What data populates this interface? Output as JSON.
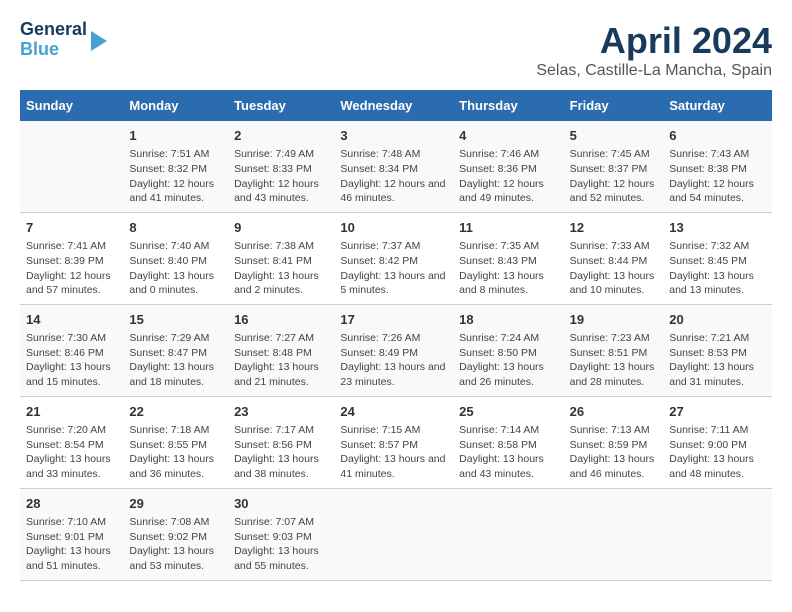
{
  "logo": {
    "line1": "General",
    "line2": "Blue"
  },
  "title": "April 2024",
  "subtitle": "Selas, Castille-La Mancha, Spain",
  "days_header": [
    "Sunday",
    "Monday",
    "Tuesday",
    "Wednesday",
    "Thursday",
    "Friday",
    "Saturday"
  ],
  "weeks": [
    [
      {
        "day": "",
        "sunrise": "",
        "sunset": "",
        "daylight": ""
      },
      {
        "day": "1",
        "sunrise": "Sunrise: 7:51 AM",
        "sunset": "Sunset: 8:32 PM",
        "daylight": "Daylight: 12 hours and 41 minutes."
      },
      {
        "day": "2",
        "sunrise": "Sunrise: 7:49 AM",
        "sunset": "Sunset: 8:33 PM",
        "daylight": "Daylight: 12 hours and 43 minutes."
      },
      {
        "day": "3",
        "sunrise": "Sunrise: 7:48 AM",
        "sunset": "Sunset: 8:34 PM",
        "daylight": "Daylight: 12 hours and 46 minutes."
      },
      {
        "day": "4",
        "sunrise": "Sunrise: 7:46 AM",
        "sunset": "Sunset: 8:36 PM",
        "daylight": "Daylight: 12 hours and 49 minutes."
      },
      {
        "day": "5",
        "sunrise": "Sunrise: 7:45 AM",
        "sunset": "Sunset: 8:37 PM",
        "daylight": "Daylight: 12 hours and 52 minutes."
      },
      {
        "day": "6",
        "sunrise": "Sunrise: 7:43 AM",
        "sunset": "Sunset: 8:38 PM",
        "daylight": "Daylight: 12 hours and 54 minutes."
      }
    ],
    [
      {
        "day": "7",
        "sunrise": "Sunrise: 7:41 AM",
        "sunset": "Sunset: 8:39 PM",
        "daylight": "Daylight: 12 hours and 57 minutes."
      },
      {
        "day": "8",
        "sunrise": "Sunrise: 7:40 AM",
        "sunset": "Sunset: 8:40 PM",
        "daylight": "Daylight: 13 hours and 0 minutes."
      },
      {
        "day": "9",
        "sunrise": "Sunrise: 7:38 AM",
        "sunset": "Sunset: 8:41 PM",
        "daylight": "Daylight: 13 hours and 2 minutes."
      },
      {
        "day": "10",
        "sunrise": "Sunrise: 7:37 AM",
        "sunset": "Sunset: 8:42 PM",
        "daylight": "Daylight: 13 hours and 5 minutes."
      },
      {
        "day": "11",
        "sunrise": "Sunrise: 7:35 AM",
        "sunset": "Sunset: 8:43 PM",
        "daylight": "Daylight: 13 hours and 8 minutes."
      },
      {
        "day": "12",
        "sunrise": "Sunrise: 7:33 AM",
        "sunset": "Sunset: 8:44 PM",
        "daylight": "Daylight: 13 hours and 10 minutes."
      },
      {
        "day": "13",
        "sunrise": "Sunrise: 7:32 AM",
        "sunset": "Sunset: 8:45 PM",
        "daylight": "Daylight: 13 hours and 13 minutes."
      }
    ],
    [
      {
        "day": "14",
        "sunrise": "Sunrise: 7:30 AM",
        "sunset": "Sunset: 8:46 PM",
        "daylight": "Daylight: 13 hours and 15 minutes."
      },
      {
        "day": "15",
        "sunrise": "Sunrise: 7:29 AM",
        "sunset": "Sunset: 8:47 PM",
        "daylight": "Daylight: 13 hours and 18 minutes."
      },
      {
        "day": "16",
        "sunrise": "Sunrise: 7:27 AM",
        "sunset": "Sunset: 8:48 PM",
        "daylight": "Daylight: 13 hours and 21 minutes."
      },
      {
        "day": "17",
        "sunrise": "Sunrise: 7:26 AM",
        "sunset": "Sunset: 8:49 PM",
        "daylight": "Daylight: 13 hours and 23 minutes."
      },
      {
        "day": "18",
        "sunrise": "Sunrise: 7:24 AM",
        "sunset": "Sunset: 8:50 PM",
        "daylight": "Daylight: 13 hours and 26 minutes."
      },
      {
        "day": "19",
        "sunrise": "Sunrise: 7:23 AM",
        "sunset": "Sunset: 8:51 PM",
        "daylight": "Daylight: 13 hours and 28 minutes."
      },
      {
        "day": "20",
        "sunrise": "Sunrise: 7:21 AM",
        "sunset": "Sunset: 8:53 PM",
        "daylight": "Daylight: 13 hours and 31 minutes."
      }
    ],
    [
      {
        "day": "21",
        "sunrise": "Sunrise: 7:20 AM",
        "sunset": "Sunset: 8:54 PM",
        "daylight": "Daylight: 13 hours and 33 minutes."
      },
      {
        "day": "22",
        "sunrise": "Sunrise: 7:18 AM",
        "sunset": "Sunset: 8:55 PM",
        "daylight": "Daylight: 13 hours and 36 minutes."
      },
      {
        "day": "23",
        "sunrise": "Sunrise: 7:17 AM",
        "sunset": "Sunset: 8:56 PM",
        "daylight": "Daylight: 13 hours and 38 minutes."
      },
      {
        "day": "24",
        "sunrise": "Sunrise: 7:15 AM",
        "sunset": "Sunset: 8:57 PM",
        "daylight": "Daylight: 13 hours and 41 minutes."
      },
      {
        "day": "25",
        "sunrise": "Sunrise: 7:14 AM",
        "sunset": "Sunset: 8:58 PM",
        "daylight": "Daylight: 13 hours and 43 minutes."
      },
      {
        "day": "26",
        "sunrise": "Sunrise: 7:13 AM",
        "sunset": "Sunset: 8:59 PM",
        "daylight": "Daylight: 13 hours and 46 minutes."
      },
      {
        "day": "27",
        "sunrise": "Sunrise: 7:11 AM",
        "sunset": "Sunset: 9:00 PM",
        "daylight": "Daylight: 13 hours and 48 minutes."
      }
    ],
    [
      {
        "day": "28",
        "sunrise": "Sunrise: 7:10 AM",
        "sunset": "Sunset: 9:01 PM",
        "daylight": "Daylight: 13 hours and 51 minutes."
      },
      {
        "day": "29",
        "sunrise": "Sunrise: 7:08 AM",
        "sunset": "Sunset: 9:02 PM",
        "daylight": "Daylight: 13 hours and 53 minutes."
      },
      {
        "day": "30",
        "sunrise": "Sunrise: 7:07 AM",
        "sunset": "Sunset: 9:03 PM",
        "daylight": "Daylight: 13 hours and 55 minutes."
      },
      {
        "day": "",
        "sunrise": "",
        "sunset": "",
        "daylight": ""
      },
      {
        "day": "",
        "sunrise": "",
        "sunset": "",
        "daylight": ""
      },
      {
        "day": "",
        "sunrise": "",
        "sunset": "",
        "daylight": ""
      },
      {
        "day": "",
        "sunrise": "",
        "sunset": "",
        "daylight": ""
      }
    ]
  ]
}
